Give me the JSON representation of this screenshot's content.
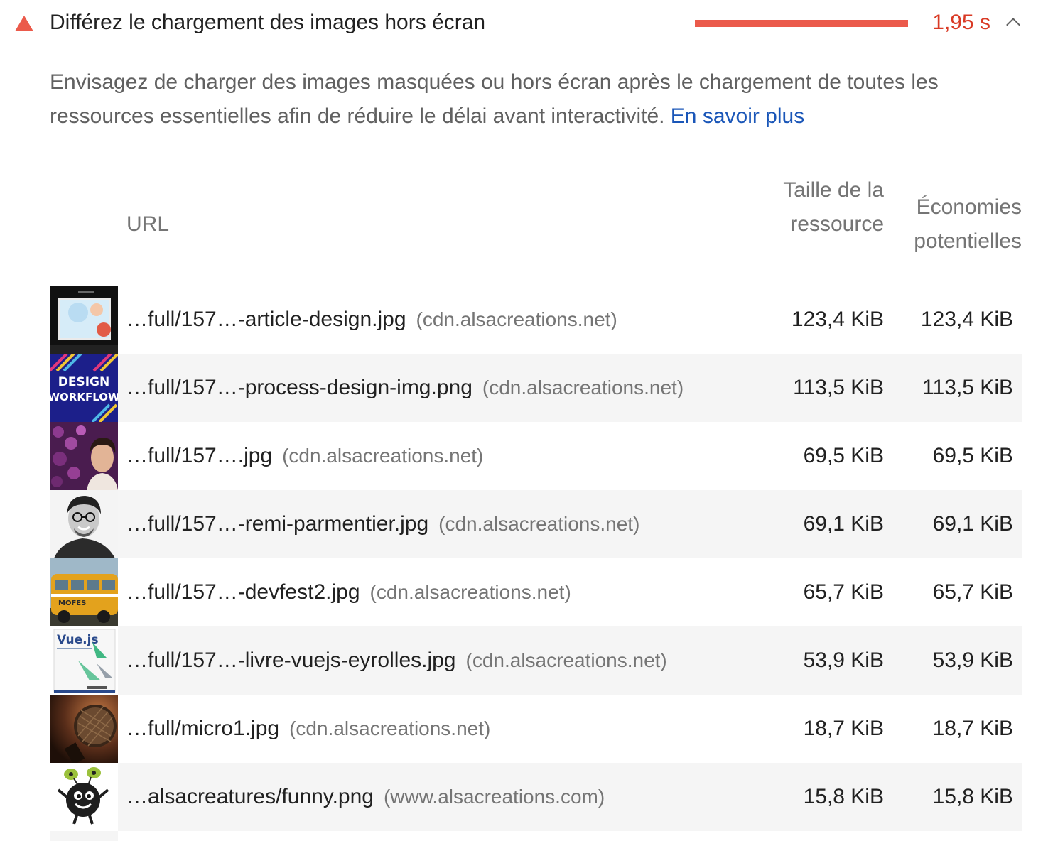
{
  "audit": {
    "title": "Différez le chargement des images hors écran",
    "value": "1,95 s",
    "bar_fraction": 1.0,
    "status_color": "#eb5a4b",
    "status_icon": "warning-triangle-icon",
    "toggle_icon": "chevron-up-icon",
    "description": "Envisagez de charger des images masquées ou hors écran après le chargement de toutes les ressources essentielles afin de réduire le délai avant interactivité.",
    "learn_more": "En savoir plus"
  },
  "table": {
    "headers": {
      "url": "URL",
      "resource_size": "Taille de la ressource",
      "potential_savings": "Économies potentielles"
    },
    "rows": [
      {
        "thumb": "article-design-thumbnail",
        "url": "…full/157…-article-design.jpg",
        "host": "(cdn.alsacreations.net)",
        "size": "123,4 KiB",
        "savings": "123,4 KiB"
      },
      {
        "thumb": "design-workflow-thumbnail",
        "thumb_text_1": "DESIGN",
        "thumb_text_2": "WORKFLOW",
        "url": "…full/157…-process-design-img.png",
        "host": "(cdn.alsacreations.net)",
        "size": "113,5 KiB",
        "savings": "113,5 KiB"
      },
      {
        "thumb": "portrait-flowers-thumbnail",
        "url": "…full/157….jpg",
        "host": "(cdn.alsacreations.net)",
        "size": "69,5 KiB",
        "savings": "69,5 KiB"
      },
      {
        "thumb": "remi-parmentier-thumbnail",
        "url": "…full/157…-remi-parmentier.jpg",
        "host": "(cdn.alsacreations.net)",
        "size": "69,1 KiB",
        "savings": "69,1 KiB"
      },
      {
        "thumb": "devfest-van-thumbnail",
        "url": "…full/157…-devfest2.jpg",
        "host": "(cdn.alsacreations.net)",
        "size": "65,7 KiB",
        "savings": "65,7 KiB"
      },
      {
        "thumb": "vuejs-book-thumbnail",
        "thumb_text_1": "Vue.js",
        "url": "…full/157…-livre-vuejs-eyrolles.jpg",
        "host": "(cdn.alsacreations.net)",
        "size": "53,9 KiB",
        "savings": "53,9 KiB"
      },
      {
        "thumb": "microphone-thumbnail",
        "url": "…full/micro1.jpg",
        "host": "(cdn.alsacreations.net)",
        "size": "18,7 KiB",
        "savings": "18,7 KiB"
      },
      {
        "thumb": "funny-creature-thumbnail",
        "url": "…alsacreatures/funny.png",
        "host": "(www.alsacreations.com)",
        "size": "15,8 KiB",
        "savings": "15,8 KiB"
      }
    ]
  }
}
